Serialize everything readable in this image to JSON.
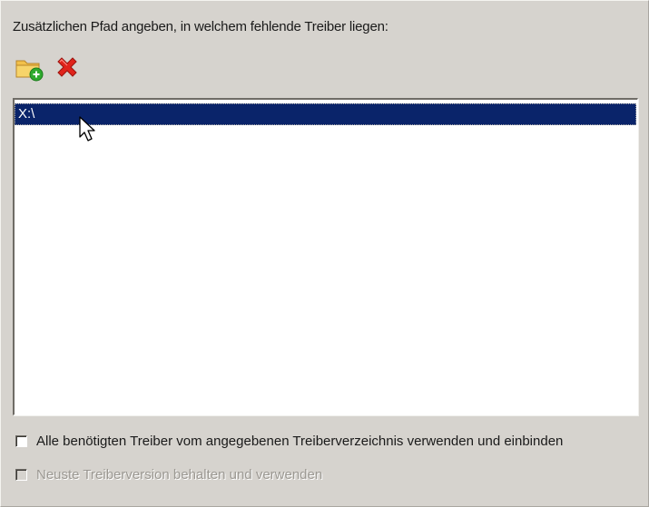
{
  "instruction_text": "Zusätzlichen Pfad angeben, in welchem fehlende Treiber liegen:",
  "toolbar": {
    "add_icon": "folder-add-icon",
    "delete_icon": "red-x-delete-icon"
  },
  "path_list": {
    "items": [
      {
        "label": "X:\\",
        "selected": true
      }
    ]
  },
  "options": {
    "use_all_drivers": {
      "label": "Alle benötigten Treiber vom angegebenen Treiberverzeichnis verwenden und einbinden",
      "checked": false,
      "enabled": true
    },
    "keep_newest_version": {
      "label": "Neuste Treiberversion behalten und verwenden",
      "checked": false,
      "enabled": false
    }
  },
  "colors": {
    "background": "#d6d3ce",
    "selection": "#0a246a",
    "delete_red": "#e0231b",
    "folder_yellow": "#f4c542",
    "add_green": "#2eaa2e"
  }
}
